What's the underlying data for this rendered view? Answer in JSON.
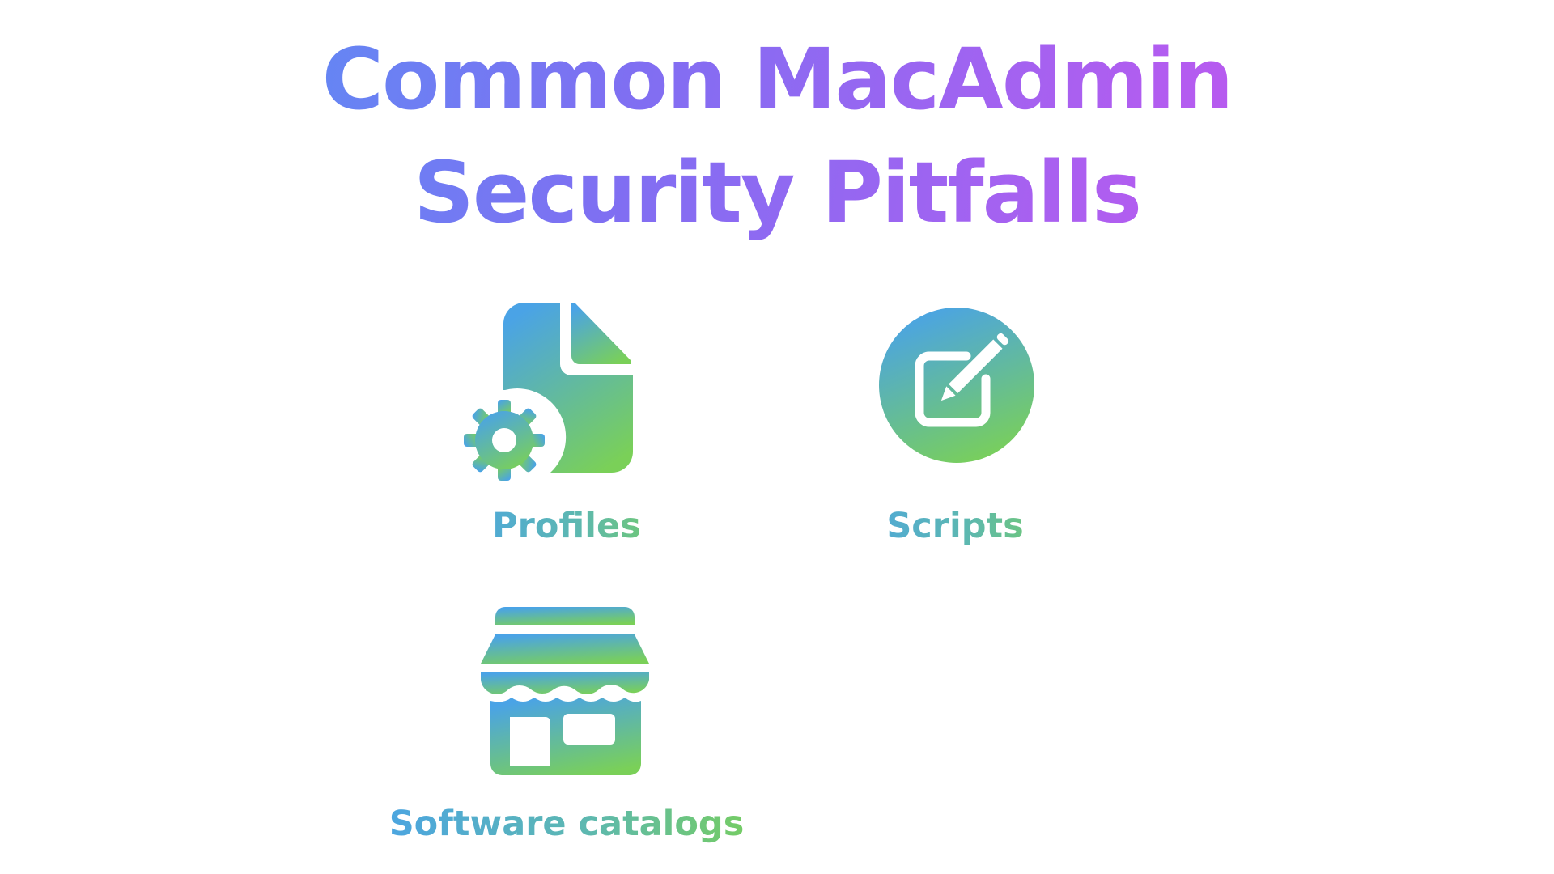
{
  "slide": {
    "title_line1": "Common MacAdmin",
    "title_line2": "Security Pitfalls"
  },
  "items": [
    {
      "label": "Profiles",
      "icon": "document-gear-icon"
    },
    {
      "label": "Scripts",
      "icon": "pencil-square-circle-icon"
    },
    {
      "label": "Software catalogs",
      "icon": "storefront-icon"
    }
  ],
  "colors": {
    "title_gradient_start": "#4a9df5",
    "title_gradient_end": "#c94fe8",
    "icon_gradient_start": "#4aa3e6",
    "icon_gradient_end": "#78cf5a"
  }
}
